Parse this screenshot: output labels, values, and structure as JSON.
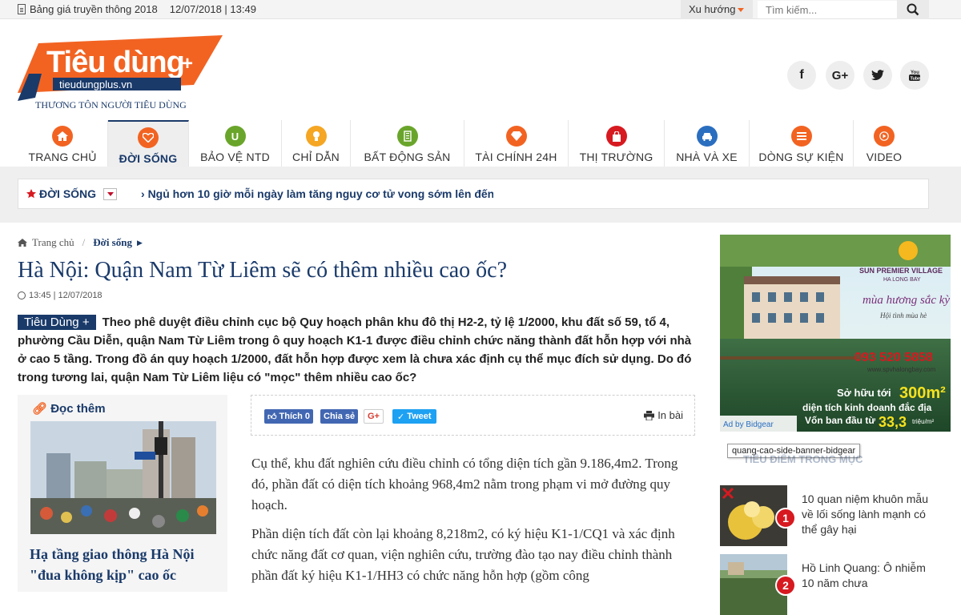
{
  "topbar": {
    "price_link": "Bảng giá truyền thông 2018",
    "datetime": "12/07/2018 | 13:49",
    "trend": "Xu hướng",
    "search_placeholder": "Tìm kiếm..."
  },
  "logo": {
    "main": "Tiêu dùng",
    "plus": "+",
    "url": "tieudungplus.vn",
    "slogan": "THƯƠNG TÔN NGƯỜI TIÊU DÙNG"
  },
  "social": [
    "facebook",
    "google-plus",
    "twitter",
    "youtube"
  ],
  "nav": [
    {
      "label": "TRANG CHỦ",
      "icon": "home-icon"
    },
    {
      "label": "ĐỜI SỐNG",
      "icon": "heart-icon"
    },
    {
      "label": "BẢO VỆ NTD",
      "icon": "shield-icon"
    },
    {
      "label": "CHỈ DẪN",
      "icon": "bulb-icon"
    },
    {
      "label": "BẤT ĐỘNG SẢN",
      "icon": "building-icon"
    },
    {
      "label": "TÀI CHÍNH 24H",
      "icon": "diamond-icon"
    },
    {
      "label": "THỊ TRƯỜNG",
      "icon": "bag-icon"
    },
    {
      "label": "NHÀ VÀ XE",
      "icon": "car-icon"
    },
    {
      "label": "DÒNG SỰ KIỆN",
      "icon": "list-icon"
    },
    {
      "label": "VIDEO",
      "icon": "play-icon"
    }
  ],
  "ticker": {
    "category": "ĐỜI SỐNG",
    "headline": "Ngủ hơn 10 giờ mỗi ngày làm tăng nguy cơ tử vong sớm lên đến _"
  },
  "breadcrumb": {
    "home": "Trang chủ",
    "current": "Đời sống"
  },
  "article": {
    "title": "Hà Nội: Quận Nam Từ Liêm sẽ có thêm nhiều cao ốc?",
    "time": "13:45 | 12/07/2018",
    "badge": "Tiêu Dùng +",
    "sapo": "Theo phê duyệt điều chỉnh cục bộ Quy hoạch phân khu đô thị H2-2, tỷ lệ 1/2000, khu đất số 59, tổ 4, phường Cầu Diễn, quận Nam Từ Liêm trong ô quy hoạch K1-1 được điều chỉnh chức năng thành đất hỗn hợp với nhà ở cao 5 tầng. Trong đồ án quy hoạch 1/2000, đất hỗn hợp được xem là chưa xác định cụ thể mục đích sử dụng. Do đó trong tương lai, quận Nam Từ Liêm liệu có \"mọc\" thêm nhiều cao ốc?",
    "p1": "Cụ thể, khu đất nghiên cứu điều chỉnh có tổng diện tích gần 9.186,4m2. Trong đó, phần đất có diện tích khoảng 968,4m2 nằm trong phạm vi mở đường quy hoạch.",
    "p2": "Phần diện tích đất còn lại khoảng 8,218m2, có ký hiệu K1-1/CQ1 và xác định chức năng đất cơ quan, viện nghiên cứu, trường đào tạo nay điều chỉnh thành phần đất ký hiệu K1-1/HH3 có chức năng hỗn hợp (gồm công"
  },
  "share": {
    "like": "Thích 0",
    "share": "Chia sẻ",
    "gplus": "G+",
    "tweet": "Tweet",
    "print": "In bài"
  },
  "readmore": {
    "heading": "Đọc thêm",
    "title": "Hạ tầng giao thông Hà Nội \"đua không kịp\" cao ốc"
  },
  "ad": {
    "brand": "SUN PREMIER VILLAGE",
    "brand_sub": "HA LONG BAY",
    "tagline": "mùa hương sắc kỳ quan",
    "sub": "Hội tình mùa hè",
    "phone": "093 520 5858",
    "web": "www.spvhalongbay.com",
    "own_pre": "Sở hữu tới",
    "area": "300m²",
    "line2": "diện tích kinh doanh đắc địa",
    "line3_pre": "Vốn ban đầu từ",
    "price": "33,3",
    "unit": "triệu/m²",
    "adby": "Ad by Bidgear"
  },
  "tooltip": "quang-cao-side-banner-bidgear",
  "side": {
    "heading": "TIÊU ĐIỂM TRONG MỤC",
    "items": [
      {
        "num": "1",
        "title": "10 quan niệm khuôn mẫu về lối sống lành mạnh có thể gây hại"
      },
      {
        "num": "2",
        "title": "Hồ Linh Quang: Ô nhiễm 10 năm chưa"
      }
    ]
  },
  "colors": {
    "brand": "#f26322",
    "navy": "#1a3a6a",
    "red": "#d71920"
  }
}
